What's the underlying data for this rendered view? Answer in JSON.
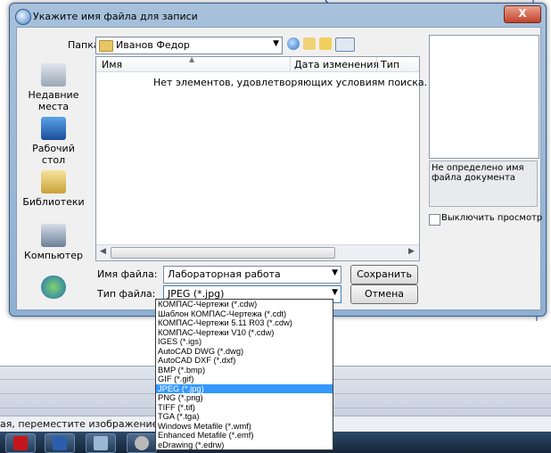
{
  "dialog": {
    "title": "Укажите имя файла для записи",
    "close_symbol": "X"
  },
  "folder_row": {
    "label": "Папка:",
    "current_folder": "Иванов Федор",
    "tools": [
      "back-icon",
      "up-folder-icon",
      "new-folder-icon",
      "view-menu-icon"
    ]
  },
  "places": [
    {
      "label": "Недавние места",
      "icon": "recent-places-icon"
    },
    {
      "label": "Рабочий стол",
      "icon": "desktop-icon"
    },
    {
      "label": "Библиотеки",
      "icon": "libraries-icon"
    },
    {
      "label": "Компьютер",
      "icon": "computer-icon"
    },
    {
      "label": "",
      "icon": "network-icon"
    }
  ],
  "file_list": {
    "columns": [
      "Имя",
      "Дата изменения",
      "Тип"
    ],
    "empty_message": "Нет элементов, удовлетворяющих условиям поиска."
  },
  "filename": {
    "label": "Имя файла:",
    "value": "Лабораторная работа"
  },
  "filetype": {
    "label": "Тип файла:",
    "selected": "JPEG (*.jpg)",
    "options": [
      "КОМПАС-Чертежи (*.cdw)",
      "Шаблон КОМПАС-Чертежа (*.cdt)",
      "КОМПАС-Чертежи 5.11 R03 (*.cdw)",
      "КОМПАС-Чертежи V10 (*.cdw)",
      "IGES (*.igs)",
      "AutoCAD DWG (*.dwg)",
      "AutoCAD DXF (*.dxf)",
      "BMP (*.bmp)",
      "GIF (*.gif)",
      "JPEG (*.jpg)",
      "PNG (*.png)",
      "TIFF (*.tif)",
      "TGA (*.tga)",
      "Windows Metafile (*.wmf)",
      "Enhanced Metafile (*.emf)",
      "eDrawing (*.edrw)"
    ],
    "selected_index": 9
  },
  "buttons": {
    "save": "Сохранить",
    "cancel": "Отмена"
  },
  "preview": {
    "message": "Не определено имя файла документа",
    "checkbox_label": "Выключить просмотр",
    "checkbox_checked": false
  },
  "background": {
    "status_text": "ая, переместите изображение",
    "taskbar_icons": [
      "acrobat-icon",
      "word-icon",
      "kompas-icon",
      "settings-icon"
    ]
  }
}
